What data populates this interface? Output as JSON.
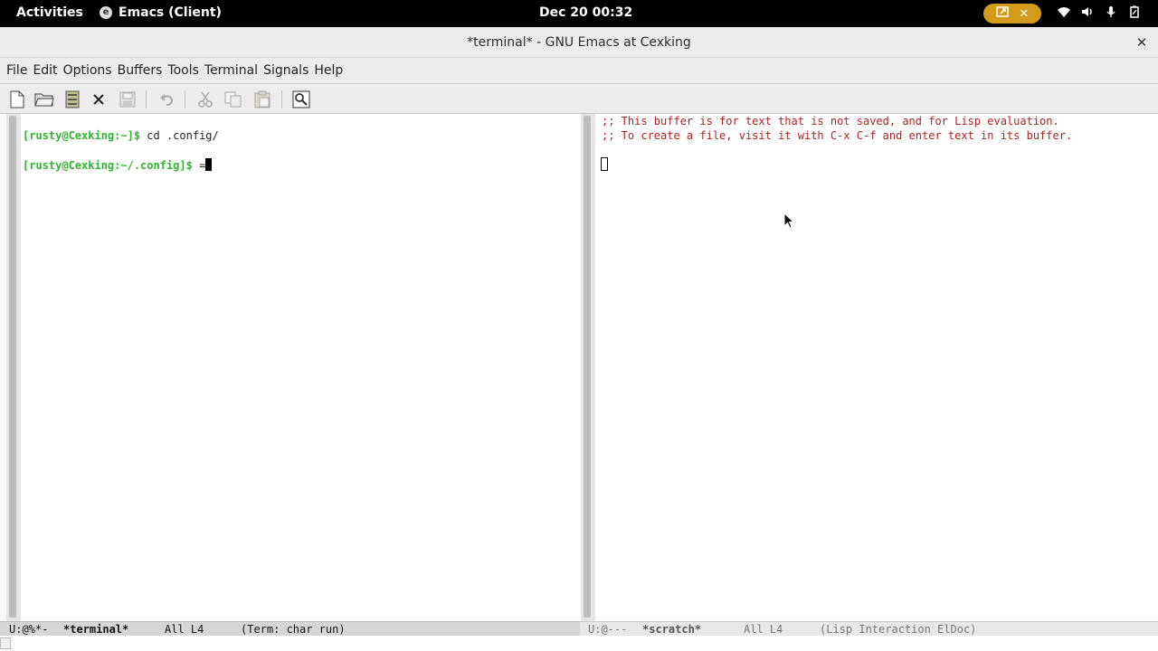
{
  "topbar": {
    "activities": "Activities",
    "app_name": "Emacs (Client)",
    "clock": "Dec 20  00:32",
    "icons": [
      "screen-share-icon",
      "close-icon",
      "wifi-icon",
      "volume-icon",
      "microphone-icon",
      "battery-icon"
    ]
  },
  "window": {
    "title": "*terminal* - GNU Emacs at Cexking",
    "close": "✕"
  },
  "menubar": {
    "items": [
      "File",
      "Edit",
      "Options",
      "Buffers",
      "Tools",
      "Terminal",
      "Signals",
      "Help"
    ]
  },
  "toolbar": {
    "buttons": [
      "new-file",
      "open-file",
      "dired",
      "kill-buffer",
      "save",
      "undo",
      "cut",
      "copy",
      "paste",
      "search"
    ]
  },
  "left_window": {
    "lines": [
      {
        "prompt": "[rusty@Cexking:~]$",
        "command": " cd .config/"
      },
      {
        "prompt": "[rusty@Cexking:~/.config]$",
        "command": " ="
      }
    ]
  },
  "right_window": {
    "lines": [
      ";; This buffer is for text that is not saved, and for Lisp evaluation.",
      ";; To create a file, visit it with C-x C-f and enter text in its buffer."
    ]
  },
  "modeline_left": {
    "status": "U:@%*-",
    "buffer": "*terminal*",
    "position": "All L4",
    "mode": "(Term: char run)"
  },
  "modeline_right": {
    "status": "U:@---",
    "buffer": "*scratch*",
    "position": "All L4",
    "mode": "(Lisp Interaction ElDoc)"
  },
  "colors": {
    "prompt": "#2fb52f",
    "comment": "#b22222",
    "pill": "#d49a1a"
  }
}
